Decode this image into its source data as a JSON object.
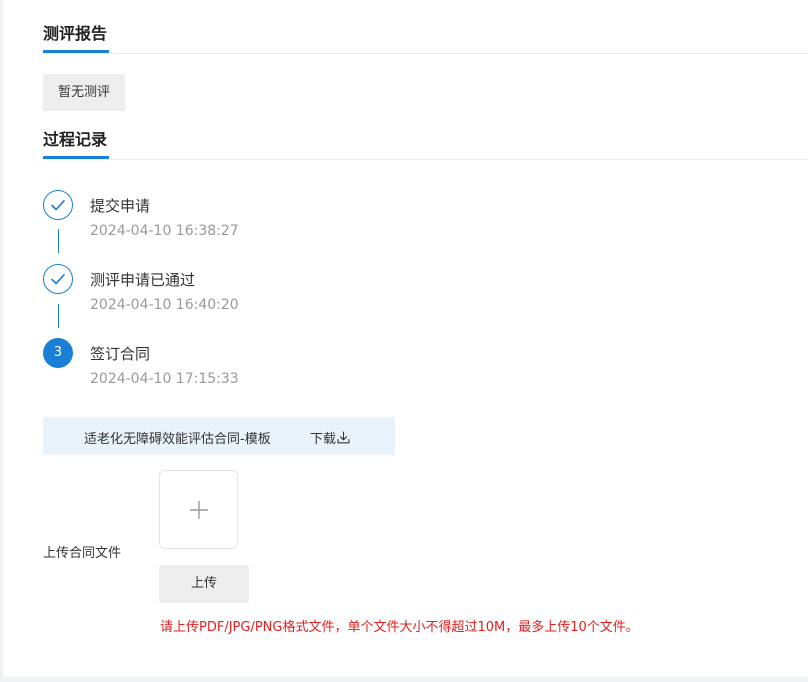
{
  "report": {
    "title": "测评报告",
    "no_report_label": "暂无测评"
  },
  "process": {
    "title": "过程记录",
    "steps": [
      {
        "status": "done",
        "icon": "check-icon",
        "title": "提交申请",
        "time": "2024-04-10 16:38:27"
      },
      {
        "status": "done",
        "icon": "check-icon",
        "title": "测评申请已通过",
        "time": "2024-04-10 16:40:20"
      },
      {
        "status": "current",
        "number": "3",
        "title": "签订合同",
        "time": "2024-04-10 17:15:33"
      }
    ]
  },
  "template": {
    "name": "适老化无障碍效能评估合同-模板",
    "download_label": "下载",
    "download_icon": "download-icon"
  },
  "upload": {
    "label": "上传合同文件",
    "button_label": "上传",
    "add_icon": "plus-icon",
    "hint": "请上传PDF/JPG/PNG格式文件，单个文件大小不得超过10M，最多上传10个文件。"
  },
  "colors": {
    "accent": "#1a7fd6",
    "hint": "#e02020",
    "template_bg": "#e9f3fc"
  }
}
